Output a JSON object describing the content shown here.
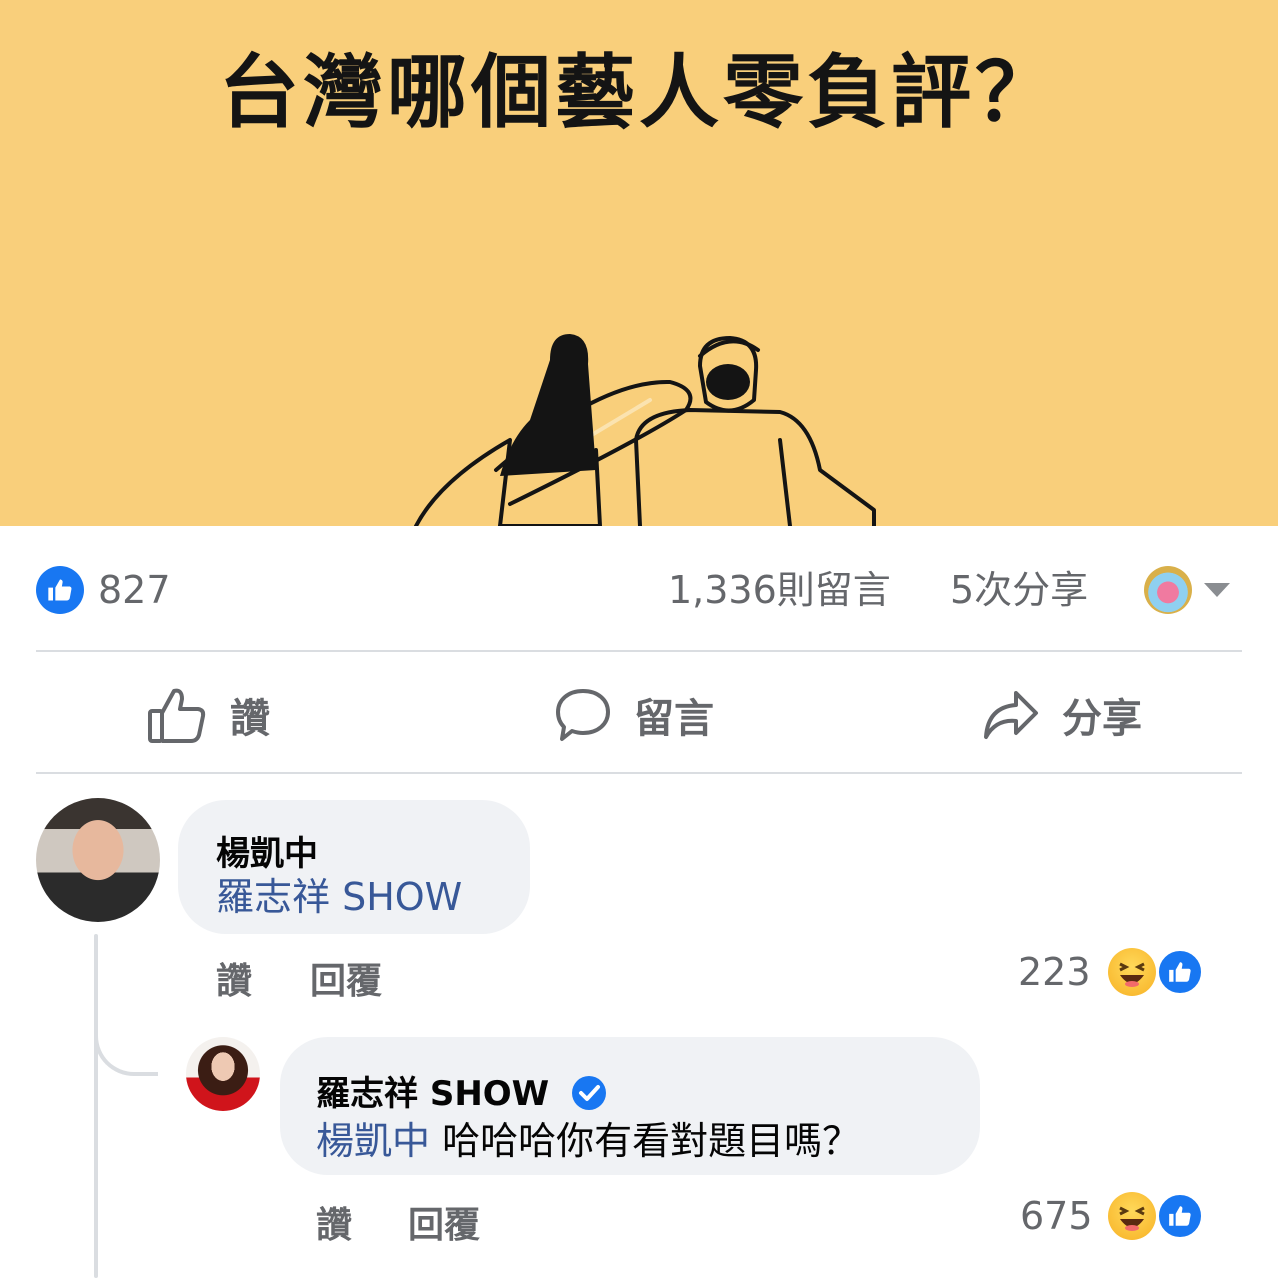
{
  "post": {
    "banner_title": "台灣哪個藝人零負評？",
    "banner_color": "#f9cf7b"
  },
  "stats": {
    "likes": "827",
    "comments": "1,336則留言",
    "shares": "5次分享"
  },
  "actions": {
    "like": "讚",
    "comment": "留言",
    "share": "分享"
  },
  "comments": [
    {
      "author": "楊凱中",
      "mention": "羅志祥 SHOW",
      "text": "",
      "like_label": "讚",
      "reply_label": "回覆",
      "reaction_count": "223"
    },
    {
      "author": "羅志祥 SHOW",
      "verified": true,
      "mention": "楊凱中",
      "text": "哈哈哈你有看對題目嗎？",
      "like_label": "讚",
      "reply_label": "回覆",
      "reaction_count": "675"
    }
  ]
}
